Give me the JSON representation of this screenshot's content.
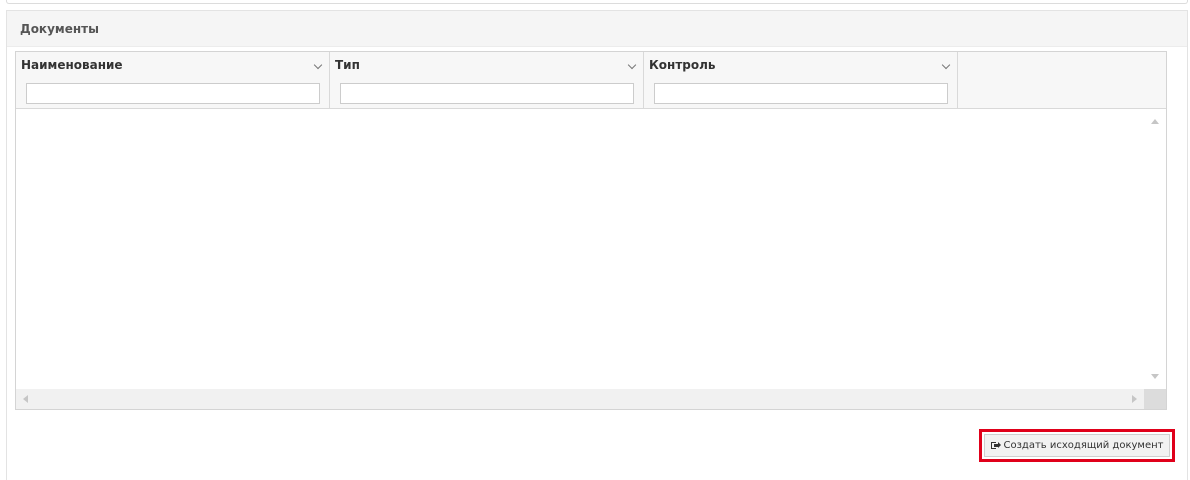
{
  "panel": {
    "title": "Документы"
  },
  "grid": {
    "columns": [
      {
        "title": "Наименование",
        "filter_value": ""
      },
      {
        "title": "Тип",
        "filter_value": ""
      },
      {
        "title": "Контроль",
        "filter_value": ""
      }
    ],
    "rows": []
  },
  "actions": {
    "create_outgoing_label": "Создать исходящий документ",
    "create_outgoing_icon": "sign-out-icon",
    "highlight_color": "#e0001a"
  }
}
